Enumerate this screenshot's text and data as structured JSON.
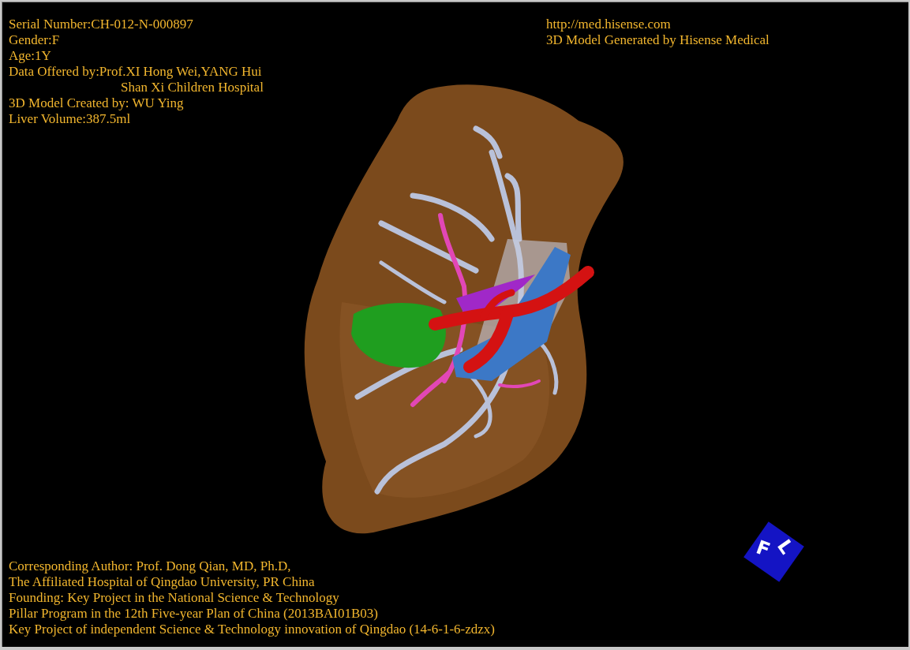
{
  "header_left": [
    {
      "kind": "line",
      "text": "Serial Number:CH-012-N-000897"
    },
    {
      "kind": "line",
      "text": "Gender:F"
    },
    {
      "kind": "line",
      "text": "Age:1Y"
    },
    {
      "kind": "line",
      "text": "Data Offered by:Prof.XI Hong Wei,YANG Hui"
    },
    {
      "kind": "continuation",
      "text": "Shan Xi Children Hospital"
    },
    {
      "kind": "line",
      "text": "3D Model Created by: WU Ying"
    },
    {
      "kind": "line",
      "text": "Liver Volume:387.5ml"
    }
  ],
  "header_right": [
    "http://med.hisense.com",
    "3D Model Generated by Hisense Medical"
  ],
  "footer": [
    "Corresponding Author: Prof. Dong Qian, MD, Ph.D,",
    "The Affiliated Hospital of Qingdao University, PR China",
    "Founding: Key Project in the National Science & Technology",
    "Pillar Program in the 12th Five-year Plan of China (2013BAI01B03)",
    "Key Project of independent Science & Technology innovation of Qingdao (14-6-1-6-zdzx)"
  ],
  "orientation_cube": {
    "faces": [
      "F",
      "L"
    ]
  }
}
